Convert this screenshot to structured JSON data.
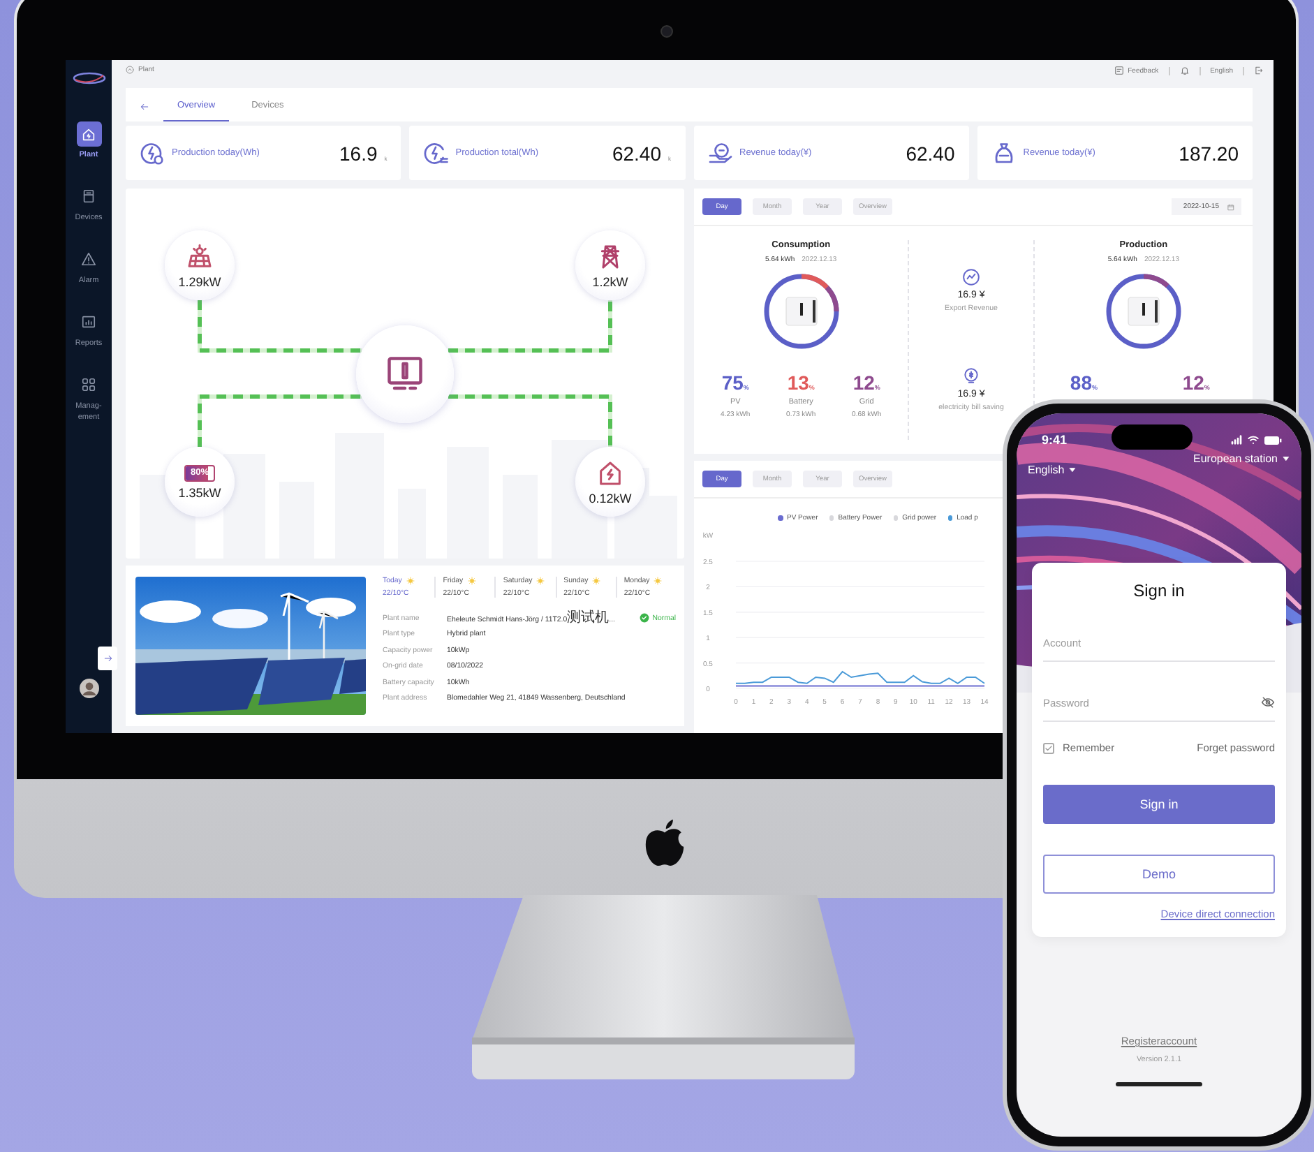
{
  "dashboard": {
    "breadcrumb": "Plant",
    "header": {
      "feedback": "Feedback",
      "language": "English"
    },
    "sidebar": [
      {
        "label": "Plant",
        "selected": true
      },
      {
        "label": "Devices",
        "selected": false
      },
      {
        "label": "Alarm",
        "selected": false
      },
      {
        "label": "Reports",
        "selected": false
      },
      {
        "label": "Manag-ement",
        "selected": false
      }
    ],
    "tabs": [
      {
        "label": "Overview",
        "selected": true
      },
      {
        "label": "Devices",
        "selected": false
      }
    ],
    "stats": [
      {
        "label": "Production today(Wh)",
        "value": "16.9",
        "unit": "k"
      },
      {
        "label": "Production total(Wh)",
        "value": "62.40",
        "unit": "k"
      },
      {
        "label": "Revenue today(¥)",
        "value": "62.40"
      },
      {
        "label": "Revenue today(¥)",
        "value": "187.20"
      }
    ],
    "energy_flow": [
      {
        "kind": "solar",
        "reading": "1.29kW"
      },
      {
        "kind": "grid",
        "reading": "1.2kW"
      },
      {
        "kind": "battery",
        "reading": "1.35kW",
        "charge": "80%",
        "level": 0.8
      },
      {
        "kind": "home",
        "reading": "0.12kW"
      }
    ],
    "plant_info": {
      "weather": [
        {
          "day": "Today",
          "temperature": "22/10°C",
          "selected": true
        },
        {
          "day": "Friday",
          "temperature": "22/10°C",
          "selected": false
        },
        {
          "day": "Saturday",
          "temperature": "22/10°C",
          "selected": false
        },
        {
          "day": "Sunday",
          "temperature": "22/10°C",
          "selected": false
        },
        {
          "day": "Monday",
          "temperature": "22/10°C",
          "selected": false
        }
      ],
      "status": "Normal",
      "fields": [
        {
          "label": "Plant name",
          "value": "Eheleute Schmidt Hans-Jörg / 11T2.0测试机..."
        },
        {
          "label": "Plant type",
          "value": "Hybrid plant"
        },
        {
          "label": "Capacity power",
          "value": "10kWp"
        },
        {
          "label": "On-grid date",
          "value": "08/10/2022"
        },
        {
          "label": "Battery capacity",
          "value": "10kWh"
        },
        {
          "label": "Plant address",
          "value": "Blomedahler Weg 21, 41849 Wassenberg, Deutschland"
        }
      ]
    },
    "summary": {
      "periods": [
        {
          "label": "Day",
          "selected": true
        },
        {
          "label": "Month",
          "selected": false
        },
        {
          "label": "Year",
          "selected": false
        },
        {
          "label": "Overview",
          "selected": false
        }
      ],
      "date": "2022-10-15",
      "consumption": {
        "title": "Consumption",
        "total": "5.64 kWh",
        "date": "2022.12.13",
        "stats": [
          {
            "value": "75",
            "unit": "%",
            "label": "PV",
            "energy": "4.23 kWh",
            "color": "#5b5fc7"
          },
          {
            "value": "13",
            "unit": "%",
            "label": "Battery",
            "energy": "0.73 kWh",
            "color": "#e05a5a"
          },
          {
            "value": "12",
            "unit": "%",
            "label": "Grid",
            "energy": "0.68 kWh",
            "color": "#8e4a8e"
          }
        ]
      },
      "revenue": [
        {
          "amount": "16.9 ¥",
          "label": "Export Revenue"
        },
        {
          "amount": "16.9 ¥",
          "label": "electricity bill saving"
        }
      ],
      "production": {
        "title": "Production",
        "total": "5.64 kWh",
        "date": "2022.12.13",
        "stats": [
          {
            "value": "88",
            "unit": "%",
            "color": "#5b5fc7"
          },
          {
            "value": "12",
            "unit": "%",
            "color": "#8e4a8e"
          }
        ]
      }
    },
    "power_chart": {
      "periods": [
        {
          "label": "Day",
          "selected": true
        },
        {
          "label": "Month",
          "selected": false
        },
        {
          "label": "Year",
          "selected": false
        },
        {
          "label": "Overview",
          "selected": false
        }
      ],
      "chart_data": {
        "type": "line",
        "ylabel": "kW",
        "grid": true,
        "x": [
          0,
          0.5,
          1,
          1.5,
          2,
          2.5,
          3,
          3.5,
          4,
          4.5,
          5,
          5.5,
          6,
          6.5,
          7,
          7.5,
          8,
          8.5,
          9,
          9.5,
          10,
          10.5,
          11,
          11.5,
          12,
          12.5,
          13,
          13.5,
          14
        ],
        "xticks": [
          0,
          1,
          2,
          3,
          4,
          5,
          6,
          7,
          8,
          9,
          10,
          11,
          12,
          13,
          14
        ],
        "yticks": [
          0,
          0.5,
          1,
          1.5,
          2,
          2.5
        ],
        "ylim": [
          0,
          2.5
        ],
        "xlim": [
          0,
          14
        ],
        "series": [
          {
            "name": "PV Power",
            "color": "#6a6cd0",
            "values": [
              0.05,
              0.05,
              0.05,
              0.05,
              0.05,
              0.05,
              0.05,
              0.05,
              0.05,
              0.05,
              0.05,
              0.05,
              0.05,
              0.05,
              0.05,
              0.05,
              0.05,
              0.05,
              0.05,
              0.05,
              0.05,
              0.05,
              0.05,
              0.05,
              0.05,
              0.05,
              0.05,
              0.05,
              0.05
            ]
          },
          {
            "name": "Battery Power",
            "color": "#d8d8dc",
            "values": [
              null,
              null,
              null,
              null,
              null,
              null,
              null,
              null,
              null,
              null,
              null,
              null,
              null,
              null,
              null,
              null,
              null,
              null,
              null,
              null,
              null,
              null,
              null,
              null,
              null,
              null,
              null,
              null,
              null
            ]
          },
          {
            "name": "Grid power",
            "color": "#d8d8dc",
            "values": [
              null,
              null,
              null,
              null,
              null,
              null,
              null,
              null,
              null,
              null,
              null,
              null,
              null,
              null,
              null,
              null,
              null,
              null,
              null,
              null,
              null,
              null,
              null,
              null,
              null,
              null,
              null,
              null,
              null
            ]
          },
          {
            "name": "Load p",
            "color": "#4a9ad8",
            "values": [
              0.1,
              0.1,
              0.12,
              0.12,
              0.22,
              0.22,
              0.22,
              0.12,
              0.1,
              0.22,
              0.2,
              0.12,
              0.33,
              0.22,
              0.25,
              0.28,
              0.3,
              0.12,
              0.12,
              0.12,
              0.25,
              0.13,
              0.1,
              0.1,
              0.2,
              0.1,
              0.22,
              0.22,
              0.1
            ]
          }
        ]
      }
    }
  },
  "phone": {
    "time": "9:41",
    "language": "English",
    "station": "European station",
    "title": "Sign in",
    "account_placeholder": "Account",
    "password_placeholder": "Password",
    "remember": {
      "label": "Remember",
      "checked": true
    },
    "forgot": "Forget password",
    "sign_in": "Sign in",
    "demo": "Demo",
    "direct": "Device direct connection",
    "register": "Registeraccount",
    "version": "Version 2.1.1"
  }
}
